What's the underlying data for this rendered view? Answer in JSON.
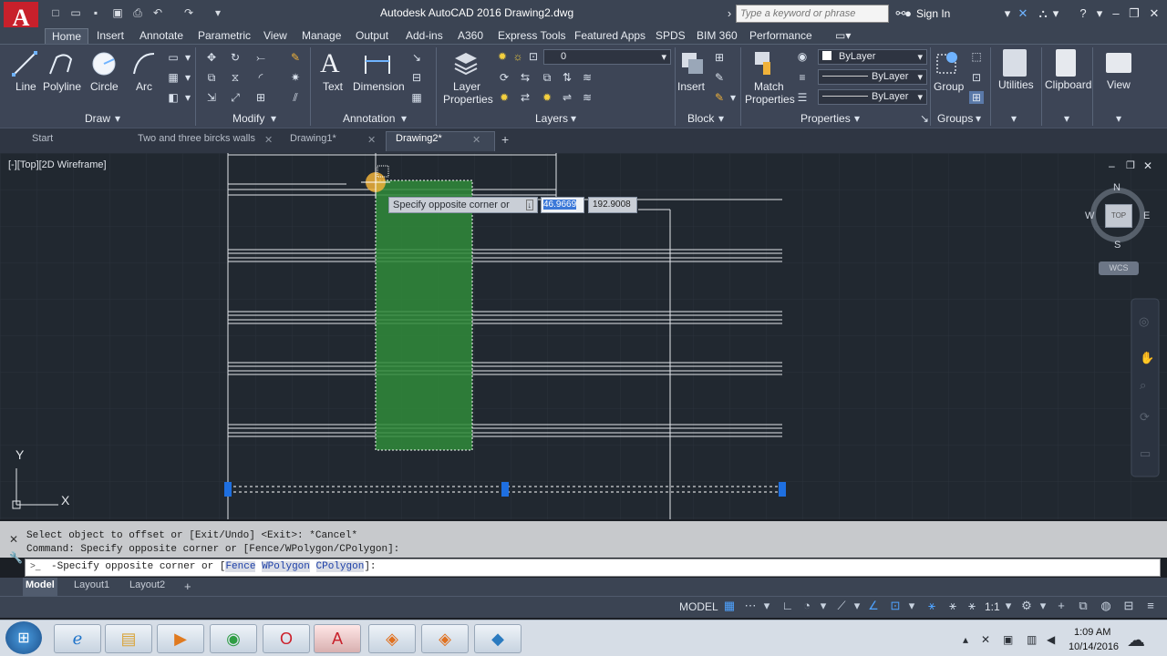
{
  "app": {
    "title": "Autodesk AutoCAD 2016   Drawing2.dwg",
    "logo": "A",
    "search_placeholder": "Type a keyword or phrase",
    "sign_in": "Sign In",
    "accent": "#c8202b"
  },
  "ribbon_tabs": [
    "Home",
    "Insert",
    "Annotate",
    "Parametric",
    "View",
    "Manage",
    "Output",
    "Add-ins",
    "A360",
    "Express Tools",
    "Featured Apps",
    "SPDS",
    "BIM 360",
    "Performance"
  ],
  "ribbon": {
    "draw": {
      "title": "Draw",
      "tools": [
        "Line",
        "Polyline",
        "Circle",
        "Arc"
      ]
    },
    "modify": {
      "title": "Modify"
    },
    "annotation": {
      "title": "Annotation",
      "tools": [
        "Text",
        "Dimension"
      ]
    },
    "layers": {
      "title": "Layers",
      "layer_properties_1": "Layer",
      "layer_properties_2": "Properties",
      "current_layer": "0"
    },
    "block": {
      "title": "Block",
      "insert": "Insert"
    },
    "properties": {
      "title": "Properties",
      "match_1": "Match",
      "match_2": "Properties",
      "color": "ByLayer",
      "linetype": "ByLayer",
      "lineweight": "ByLayer"
    },
    "groups": {
      "title": "Groups",
      "group": "Group"
    },
    "utilities": "Utilities",
    "clipboard": "Clipboard",
    "view": "View"
  },
  "file_tabs": [
    "Start",
    "Two and three bircks walls",
    "Drawing1*",
    "Drawing2*"
  ],
  "viewport": {
    "label": "[-][Top][2D Wireframe]",
    "prompt": "Specify opposite corner or",
    "coord_x": "46.9669",
    "coord_y": "192.9008",
    "viewcube_top": "TOP",
    "compass": {
      "n": "N",
      "s": "S",
      "e": "E",
      "w": "W"
    },
    "wcs": "WCS",
    "ucs_x": "X",
    "ucs_y": "Y"
  },
  "command": {
    "history_1": "Select object to offset or [Exit/Undo] <Exit>: *Cancel*",
    "history_2": "Command: Specify opposite corner or [Fence/WPolygon/CPolygon]:",
    "input_prefix": "Specify opposite corner or [",
    "opt_fence": "Fence",
    "opt_wpolygon": "WPolygon",
    "opt_cpolygon": "CPolygon",
    "input_suffix": "]:"
  },
  "layout_tabs": [
    "Model",
    "Layout1",
    "Layout2"
  ],
  "status": {
    "model": "MODEL",
    "scale": "1:1"
  },
  "taskbar": {
    "time": "1:09 AM",
    "date": "10/14/2016"
  }
}
